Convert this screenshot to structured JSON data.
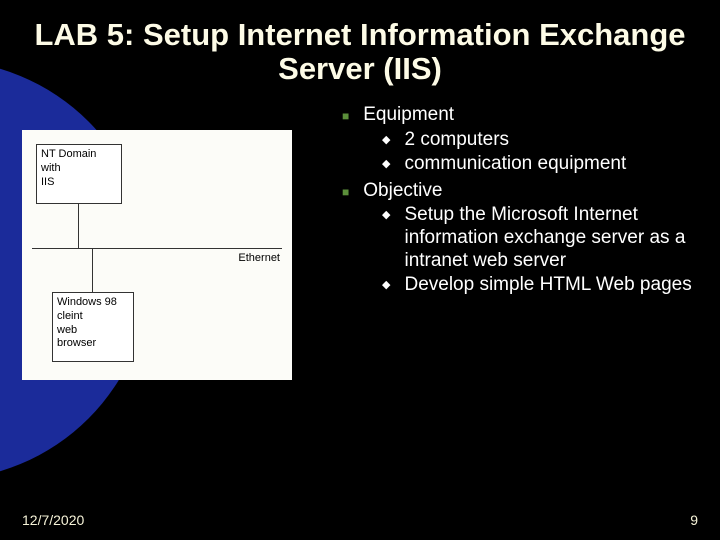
{
  "title": "LAB 5: Setup Internet Information Exchange Server (IIS)",
  "diagram": {
    "box1": [
      "NT Domain",
      "with",
      "IIS"
    ],
    "ethernet": "Ethernet",
    "box2": [
      "Windows 98",
      "cleint",
      "web",
      "browser"
    ]
  },
  "bullets": [
    {
      "label": "Equipment",
      "children": [
        "2 computers",
        "communication equipment"
      ]
    },
    {
      "label": "Objective",
      "children": [
        "Setup the Microsoft Internet information exchange server as a intranet web server",
        "Develop simple HTML Web pages"
      ]
    }
  ],
  "footer": {
    "date": "12/7/2020",
    "page": "9"
  }
}
